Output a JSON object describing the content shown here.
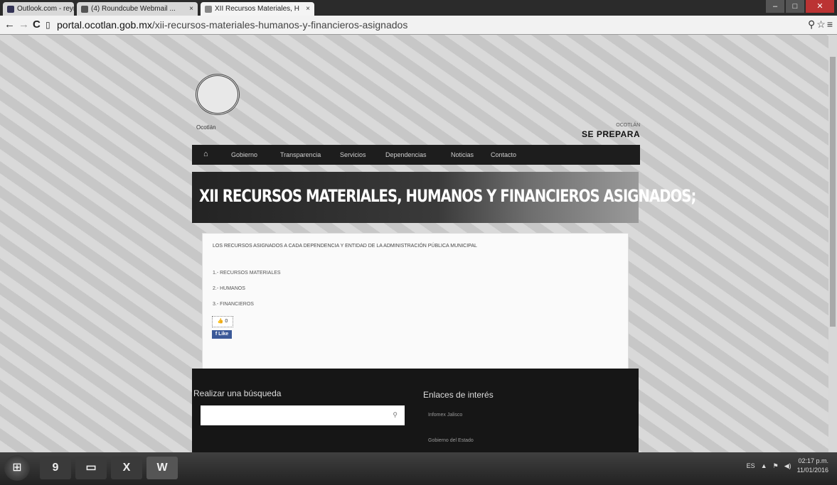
{
  "browser": {
    "tabs": [
      {
        "label": "Outlook.com - reyra fra..."
      },
      {
        "label": "(4) Roundcube Webmail ..."
      },
      {
        "label": "XII Recursos Materiales, H"
      }
    ],
    "url_host": "portal.ocotlan.gob.mx",
    "url_path": "/xii-recursos-materiales-humanos-y-financieros-asignados"
  },
  "site": {
    "logo_caption": "Ocotlán",
    "tagline_small": "OCOTLÁN",
    "tagline_big": "SE PREPARA",
    "nav": [
      "Gobierno",
      "Transparencia",
      "Servicios",
      "Dependencias",
      "Noticias",
      "Contacto"
    ],
    "page_title": "XII RECURSOS MATERIALES, HUMANOS Y FINANCIEROS ASIGNADOS;",
    "intro": "LOS RECURSOS ASIGNADOS A CADA DEPENDENCIA Y ENTIDAD DE LA ADMINISTRACIÓN PÚBLICA MUNICIPAL",
    "links": [
      "1.- RECURSOS MATERIALES",
      "2.- HUMANOS",
      "3.- FINANCIEROS"
    ],
    "like_label": "0",
    "fb_label": "f Like",
    "footer": {
      "search_heading": "Realizar una búsqueda",
      "links_heading": "Enlaces de interés",
      "links": [
        "Infomex Jalisco",
        "Gobierno del Estado"
      ]
    }
  },
  "taskbar": {
    "apps": [
      "9",
      "X",
      "W"
    ],
    "tray_lang": "ES",
    "time": "02:17 p.m.",
    "date": "11/01/2016"
  }
}
